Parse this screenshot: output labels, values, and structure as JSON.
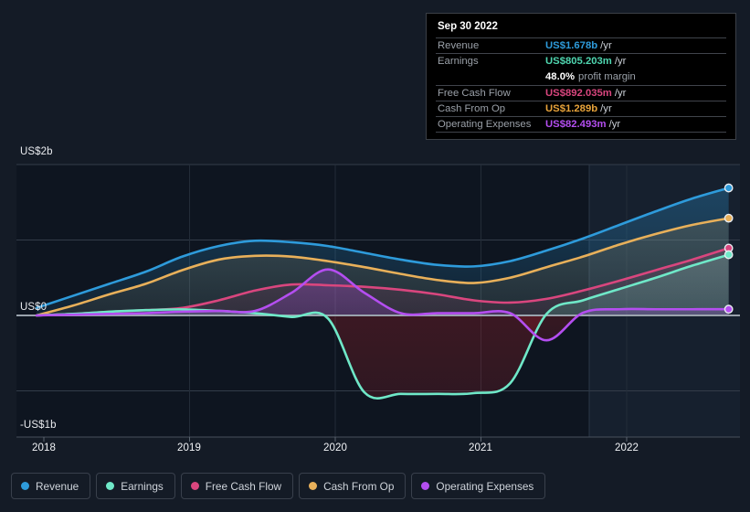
{
  "chart_data": {
    "type": "area",
    "title": "",
    "xlabel": "",
    "ylabel": "",
    "grid": true,
    "legend_position": "bottom",
    "ylim": [
      -1.2,
      2.2
    ],
    "y_ticks": [
      {
        "label": "US$2b",
        "value": 2
      },
      {
        "label": "US$0",
        "value": 0
      },
      {
        "label": "-US$1b",
        "value": -1
      }
    ],
    "x_ticks": [
      "2018",
      "2019",
      "2020",
      "2021",
      "2022"
    ],
    "forecast_boundary_label": "2021.8",
    "units": "US$ billions per year",
    "series": [
      {
        "name": "Revenue",
        "color": "#2e9bdb",
        "x": [
          2017.95,
          2018.2,
          2018.45,
          2018.7,
          2018.95,
          2019.2,
          2019.45,
          2019.7,
          2019.95,
          2020.2,
          2020.45,
          2020.7,
          2020.95,
          2021.2,
          2021.45,
          2021.7,
          2021.95,
          2022.2,
          2022.45,
          2022.7
        ],
        "values": [
          0.1,
          0.26,
          0.42,
          0.58,
          0.78,
          0.92,
          0.99,
          0.97,
          0.92,
          0.83,
          0.74,
          0.67,
          0.65,
          0.72,
          0.86,
          1.02,
          1.2,
          1.38,
          1.55,
          1.69
        ]
      },
      {
        "name": "Earnings",
        "color": "#6fe8c8",
        "x": [
          2017.95,
          2018.2,
          2018.45,
          2018.7,
          2018.95,
          2019.2,
          2019.45,
          2019.7,
          2019.95,
          2020.2,
          2020.45,
          2020.7,
          2020.95,
          2021.2,
          2021.45,
          2021.7,
          2021.95,
          2022.2,
          2022.45,
          2022.7
        ],
        "values": [
          0.0,
          0.02,
          0.05,
          0.07,
          0.08,
          0.06,
          0.03,
          -0.02,
          -0.04,
          -1.02,
          -1.04,
          -1.04,
          -1.03,
          -0.9,
          0.02,
          0.2,
          0.35,
          0.5,
          0.66,
          0.805
        ]
      },
      {
        "name": "Free Cash Flow",
        "color": "#d9467e",
        "x": [
          2017.95,
          2018.2,
          2018.45,
          2018.7,
          2018.95,
          2019.2,
          2019.45,
          2019.7,
          2019.95,
          2020.2,
          2020.45,
          2020.7,
          2020.95,
          2021.2,
          2021.45,
          2021.7,
          2021.95,
          2022.2,
          2022.45,
          2022.7
        ],
        "values": [
          0.0,
          0.02,
          0.05,
          0.07,
          0.1,
          0.2,
          0.33,
          0.41,
          0.4,
          0.38,
          0.34,
          0.28,
          0.2,
          0.17,
          0.22,
          0.33,
          0.46,
          0.6,
          0.74,
          0.892
        ]
      },
      {
        "name": "Cash From Op",
        "color": "#e8b05a",
        "x": [
          2017.95,
          2018.2,
          2018.45,
          2018.7,
          2018.95,
          2019.2,
          2019.45,
          2019.7,
          2019.95,
          2020.2,
          2020.45,
          2020.7,
          2020.95,
          2021.2,
          2021.45,
          2021.7,
          2021.95,
          2022.2,
          2022.45,
          2022.7
        ],
        "values": [
          0.0,
          0.13,
          0.28,
          0.42,
          0.6,
          0.74,
          0.79,
          0.78,
          0.72,
          0.64,
          0.55,
          0.47,
          0.43,
          0.5,
          0.64,
          0.78,
          0.94,
          1.08,
          1.2,
          1.289
        ]
      },
      {
        "name": "Operating Expenses",
        "color": "#b44ef0",
        "x": [
          2017.95,
          2018.2,
          2018.45,
          2018.7,
          2018.95,
          2019.2,
          2019.45,
          2019.7,
          2019.95,
          2020.2,
          2020.45,
          2020.7,
          2020.95,
          2021.2,
          2021.45,
          2021.7,
          2021.95,
          2022.2,
          2022.45,
          2022.7
        ],
        "values": [
          0.0,
          0.01,
          0.02,
          0.03,
          0.05,
          0.06,
          0.06,
          0.3,
          0.61,
          0.3,
          0.03,
          0.03,
          0.03,
          0.03,
          -0.33,
          0.035,
          0.082,
          0.082,
          0.082,
          0.0825
        ]
      }
    ]
  },
  "tooltip": {
    "date": "Sep 30 2022",
    "rows": [
      {
        "key": "Revenue",
        "value": "US$1.678b",
        "unit": "/yr",
        "color": "#2e9bdb"
      },
      {
        "key": "Earnings",
        "value": "US$805.203m",
        "unit": "/yr",
        "color": "#4fd6b0"
      },
      {
        "key": "Free Cash Flow",
        "value": "US$892.035m",
        "unit": "/yr",
        "color": "#d9467e"
      },
      {
        "key": "Cash From Op",
        "value": "US$1.289b",
        "unit": "/yr",
        "color": "#e8a33a"
      },
      {
        "key": "Operating Expenses",
        "value": "US$82.493m",
        "unit": "/yr",
        "color": "#b44ef0"
      }
    ],
    "profit_margin_value": "48.0%",
    "profit_margin_label": "profit margin"
  },
  "legend": {
    "items": [
      {
        "label": "Revenue",
        "color": "#2e9bdb"
      },
      {
        "label": "Earnings",
        "color": "#6fe8c8"
      },
      {
        "label": "Free Cash Flow",
        "color": "#d9467e"
      },
      {
        "label": "Cash From Op",
        "color": "#e8b05a"
      },
      {
        "label": "Operating Expenses",
        "color": "#b44ef0"
      }
    ]
  }
}
